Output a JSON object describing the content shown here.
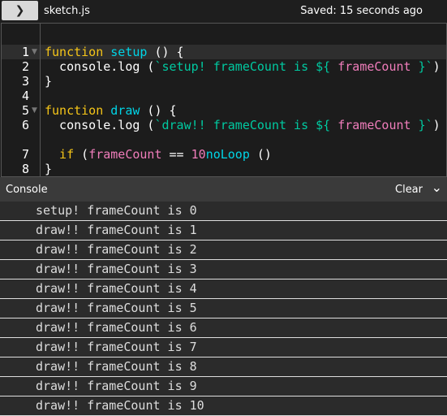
{
  "header": {
    "toggle_icon": "chevron-right-icon",
    "filename": "sketch.js",
    "saved": "Saved: 15 seconds ago"
  },
  "editor": {
    "lines": [
      {
        "n": "1",
        "fold": true,
        "tokens": [
          [
            "kw",
            "function"
          ],
          [
            "",
            "  "
          ],
          [
            "fn",
            "setup"
          ],
          [
            "",
            " () {"
          ]
        ]
      },
      {
        "n": "2",
        "tokens": [
          [
            "",
            "  console.log ("
          ],
          [
            "str",
            "`setup! frameCount is ${ "
          ],
          [
            "var",
            "frameCount"
          ],
          [
            "str",
            " }`"
          ],
          [
            "",
            ")"
          ]
        ]
      },
      {
        "n": "3",
        "tokens": [
          [
            "",
            "}"
          ]
        ]
      },
      {
        "n": "4",
        "tokens": []
      },
      {
        "n": "5",
        "fold": true,
        "tokens": [
          [
            "kw",
            "function"
          ],
          [
            "",
            " "
          ],
          [
            "fn",
            "draw"
          ],
          [
            "",
            " () {"
          ]
        ]
      },
      {
        "n": "6",
        "tokens": [
          [
            "",
            "  console.log ("
          ],
          [
            "str",
            "`draw!! frameCount is ${ "
          ],
          [
            "var",
            "frameCount"
          ],
          [
            "str",
            " }`"
          ],
          [
            "",
            ")"
          ]
        ]
      },
      {
        "n": "7",
        "tokens": [
          [
            "kw",
            "  if"
          ],
          [
            "",
            " ("
          ],
          [
            "var",
            "frameCount"
          ],
          [
            "",
            " == "
          ],
          [
            "num",
            "10"
          ],
          [
            ") "
          ],
          [
            "fn",
            "noLoop"
          ],
          [
            "",
            " ()"
          ]
        ]
      },
      {
        "n": "8",
        "tokens": [
          [
            "",
            "}"
          ]
        ]
      }
    ]
  },
  "console": {
    "title": "Console",
    "clear": "Clear",
    "collapse_icon": "chevron-down-icon",
    "rows": [
      "setup! frameCount is 0",
      "draw!! frameCount is 1",
      "draw!! frameCount is 2",
      "draw!! frameCount is 3",
      "draw!! frameCount is 4",
      "draw!! frameCount is 5",
      "draw!! frameCount is 6",
      "draw!! frameCount is 7",
      "draw!! frameCount is 8",
      "draw!! frameCount is 9",
      "draw!! frameCount is 10"
    ]
  }
}
